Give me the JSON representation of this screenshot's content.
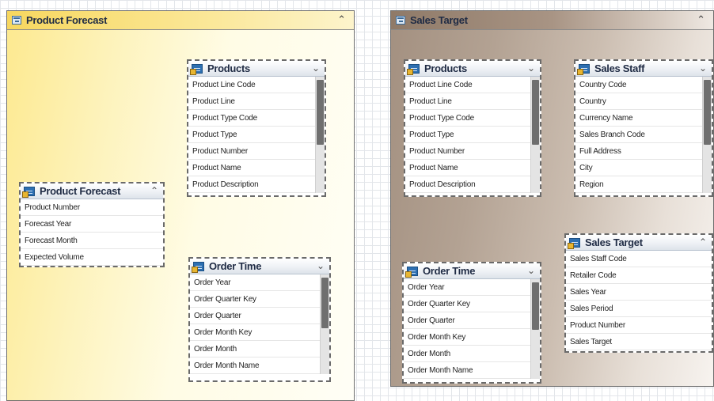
{
  "diagram": {
    "namespaces": [
      {
        "title": "Product Forecast",
        "collapse_icon": "double-chevron-up-icon",
        "entities": [
          {
            "title": "Products",
            "toggle_icon": "double-chevron-down-icon",
            "fields": [
              "Product Line Code",
              "Product Line",
              "Product Type Code",
              "Product Type",
              "Product Number",
              "Product Name",
              "Product Description"
            ]
          },
          {
            "title": "Product Forecast",
            "toggle_icon": "double-chevron-up-icon",
            "fields": [
              "Product Number",
              "Forecast Year",
              "Forecast Month",
              "Expected Volume"
            ]
          },
          {
            "title": "Order Time",
            "toggle_icon": "double-chevron-down-icon",
            "fields": [
              "Order Year",
              "Order Quarter Key",
              "Order Quarter",
              "Order Month Key",
              "Order Month",
              "Order Month Name"
            ]
          }
        ]
      },
      {
        "title": "Sales Target",
        "collapse_icon": "double-chevron-up-icon",
        "entities": [
          {
            "title": "Products",
            "toggle_icon": "double-chevron-down-icon",
            "fields": [
              "Product Line Code",
              "Product Line",
              "Product Type Code",
              "Product Type",
              "Product Number",
              "Product Name",
              "Product Description"
            ]
          },
          {
            "title": "Sales Staff",
            "toggle_icon": "double-chevron-down-icon",
            "fields": [
              "Country Code",
              "Country",
              "Currency Name",
              "Sales Branch Code",
              "Full Address",
              "City",
              "Region"
            ]
          },
          {
            "title": "Sales Target",
            "toggle_icon": "double-chevron-up-icon",
            "fields": [
              "Sales Staff Code",
              "Retailer Code",
              "Sales Year",
              "Sales Period",
              "Product Number",
              "Sales Target"
            ]
          },
          {
            "title": "Order Time",
            "toggle_icon": "double-chevron-down-icon",
            "fields": [
              "Order Year",
              "Order Quarter Key",
              "Order Quarter",
              "Order Month Key",
              "Order Month",
              "Order Month Name"
            ]
          }
        ]
      }
    ]
  }
}
